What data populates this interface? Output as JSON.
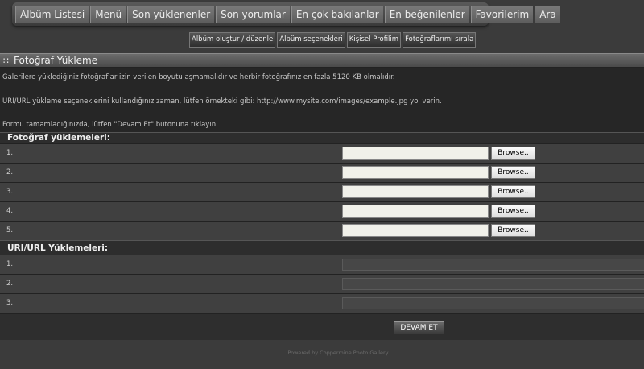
{
  "nav": {
    "items": [
      "Albüm Listesi",
      "Menü",
      "Son yüklenenler",
      "Son yorumlar",
      "En çok bakılanlar",
      "En beğenilenler",
      "Favorilerim",
      "Ara"
    ]
  },
  "subnav": {
    "items": [
      "Albüm oluştur / düzenle",
      "Albüm seçenekleri",
      "Kişisel Profilim",
      "Fotoğraflarımı sırala"
    ]
  },
  "page": {
    "title": "Fotoğraf Yükleme",
    "info_1": "Galerilere yüklediğiniz fotoğraflar izin verilen boyutu aşmamalıdır ve herbir fotoğrafınız en fazla 5120 KB olmalıdır.",
    "info_2": "URI/URL yükleme seçeneklerini kullandığınız zaman, lütfen örnekteki gibi: http://www.mysite.com/images/example.jpg yol verin.",
    "info_3": "Formu tamamladığınızda, lütfen \"Devam Et\" butonuna tıklayın."
  },
  "file_uploads": {
    "header": "Fotoğraf yüklemeleri:",
    "rows": [
      "1.",
      "2.",
      "3.",
      "4.",
      "5."
    ],
    "browse_label": "Browse..",
    "input_value": ""
  },
  "url_uploads": {
    "header": "URI/URL Yüklemeleri:",
    "rows": [
      "1.",
      "2.",
      "3."
    ],
    "input_value": ""
  },
  "submit": {
    "label": "DEVAM ET"
  },
  "footer": {
    "text": "Powered by Coppermine Photo Gallery"
  }
}
